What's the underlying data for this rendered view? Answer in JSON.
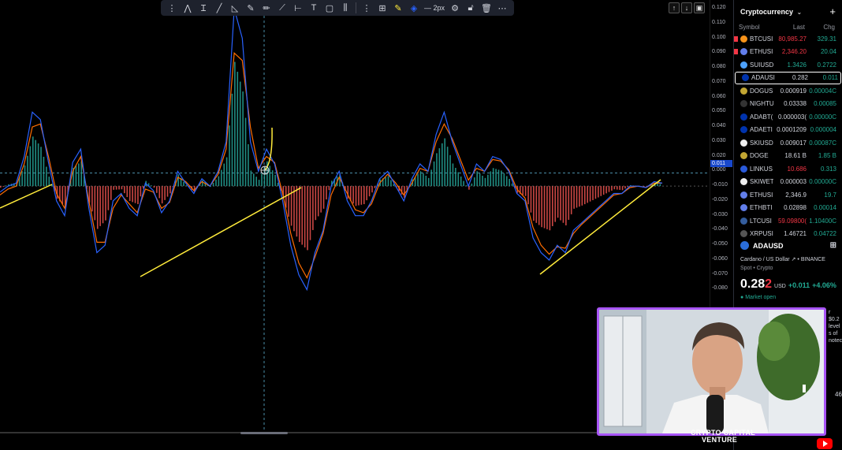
{
  "toolbar": {
    "line_width_label": "2px"
  },
  "price_axis": {
    "ticks": [
      "0.120",
      "0.110",
      "0.100",
      "0.090",
      "0.080",
      "0.070",
      "0.060",
      "0.050",
      "0.040",
      "0.030",
      "0.020",
      "0.011",
      "0.000",
      "-0.010",
      "-0.020",
      "-0.030",
      "-0.040",
      "-0.050",
      "-0.060",
      "-0.070",
      "-0.080"
    ],
    "highlight_label": "0.011",
    "highlight_color": "#1848cc"
  },
  "watchlist": {
    "title": "Cryptocurrency",
    "columns": {
      "symbol": "Symbol",
      "last": "Last",
      "chg": "Chg"
    },
    "rows": [
      {
        "symbol": "BTCUSI",
        "last": "80,985.27",
        "chg": "329.31",
        "last_color": "#f23645",
        "chg_color": "#22ab94",
        "coin_color": "#f7931a",
        "flag": true
      },
      {
        "symbol": "ETHUSI",
        "last": "2,346.20",
        "chg": "20.04",
        "last_color": "#f23645",
        "chg_color": "#22ab94",
        "coin_color": "#627eea",
        "flag": true
      },
      {
        "symbol": "SUIUSD",
        "last": "1.3426",
        "chg": "0.2722",
        "last_color": "#22ab94",
        "chg_color": "#22ab94",
        "coin_color": "#4da2ff",
        "flag": false
      },
      {
        "symbol": "ADAUSI",
        "last": "0.282",
        "chg": "0.011",
        "last_color": "#d1d4dc",
        "chg_color": "#22ab94",
        "coin_color": "#0033ad",
        "flag": false,
        "selected": true
      },
      {
        "symbol": "DOGUS",
        "last": "0.000919",
        "chg": "0.00004C",
        "last_color": "#d1d4dc",
        "chg_color": "#22ab94",
        "coin_color": "#c2a633",
        "flag": false
      },
      {
        "symbol": "NIGHTU",
        "last": "0.03338",
        "chg": "0.00085",
        "last_color": "#d1d4dc",
        "chg_color": "#22ab94",
        "coin_color": "#333333",
        "flag": false
      },
      {
        "symbol": "ADABT(",
        "last": "0.000003(",
        "chg": "0.00000C",
        "last_color": "#d1d4dc",
        "chg_color": "#22ab94",
        "coin_color": "#0033ad",
        "flag": false
      },
      {
        "symbol": "ADAETI",
        "last": "0.0001209",
        "chg": "0.000004",
        "last_color": "#d1d4dc",
        "chg_color": "#22ab94",
        "coin_color": "#0033ad",
        "flag": false
      },
      {
        "symbol": "SKIUSD",
        "last": "0.009017",
        "chg": "0.00087C",
        "last_color": "#d1d4dc",
        "chg_color": "#22ab94",
        "coin_color": "#eeeeee",
        "flag": false
      },
      {
        "symbol": "DOGE",
        "last": "18.61 B",
        "chg": "1.85 B",
        "last_color": "#d1d4dc",
        "chg_color": "#22ab94",
        "coin_color": "#c2a633",
        "flag": false
      },
      {
        "symbol": "LINKUS",
        "last": "10.686",
        "chg": "0.313",
        "last_color": "#f23645",
        "chg_color": "#22ab94",
        "coin_color": "#2a5ada",
        "flag": false
      },
      {
        "symbol": "SKIWET",
        "last": "0.000003",
        "chg": "0.00000C",
        "last_color": "#d1d4dc",
        "chg_color": "#22ab94",
        "coin_color": "#eeeeee",
        "flag": false
      },
      {
        "symbol": "ETHUSI",
        "last": "2,346.9",
        "chg": "19.7",
        "last_color": "#d1d4dc",
        "chg_color": "#22ab94",
        "coin_color": "#627eea",
        "flag": false
      },
      {
        "symbol": "ETHBTI",
        "last": "0.02898",
        "chg": "0.00014",
        "last_color": "#d1d4dc",
        "chg_color": "#22ab94",
        "coin_color": "#627eea",
        "flag": false
      },
      {
        "symbol": "LTCUSI",
        "last": "59.09800(",
        "chg": "1.10400C",
        "last_color": "#f23645",
        "chg_color": "#22ab94",
        "coin_color": "#345d9d",
        "flag": false
      },
      {
        "symbol": "XRPUSI",
        "last": "1.46721",
        "chg": "0.04722",
        "last_color": "#d1d4dc",
        "chg_color": "#22ab94",
        "coin_color": "#555555",
        "flag": false
      }
    ]
  },
  "details": {
    "symbol": "ADAUSD",
    "name": "Cardano / US Dollar",
    "exchange": "BINANCE",
    "type": "Spot • Crypto",
    "price_main": "0.28",
    "price_last_digit": "2",
    "currency": "USD",
    "change": "+0.011",
    "change_pct": "+4.06%",
    "market_status": "Market open",
    "partial_text": [
      "r $0.2",
      "level",
      "s of",
      "notec"
    ],
    "partial_number": "46"
  },
  "webcam": {
    "brand_line1": "CRYPTO CAPITAL",
    "brand_line2": "VENTURE"
  },
  "colors": {
    "macd_line": "#2962ff",
    "signal_line": "#ff6d00",
    "hist_pos": "#26a69a",
    "hist_neg": "#ef5350",
    "trendline": "#ffeb3b",
    "accent_purple": "#a855f7"
  },
  "chart_data": {
    "type": "line",
    "ylim": [
      -0.08,
      0.12
    ],
    "series": [
      {
        "values": [
          -0.004,
          0.0,
          0.002,
          0.02,
          0.05,
          0.045,
          0.016,
          -0.01,
          -0.02,
          0.016,
          0.025,
          -0.015,
          -0.045,
          -0.04,
          -0.01,
          -0.005,
          -0.015,
          -0.02,
          0.002,
          -0.003,
          -0.018,
          -0.01,
          0.01,
          0.002,
          -0.005,
          0.005,
          0.0,
          0.01,
          0.03,
          0.12,
          0.1,
          0.03,
          0.01,
          0.025,
          0.015,
          -0.01,
          -0.04,
          -0.06,
          -0.07,
          -0.045,
          -0.03,
          0.0,
          0.01,
          -0.01,
          -0.02,
          -0.02,
          -0.01,
          0.005,
          0.01,
          0.0,
          -0.01,
          0.005,
          0.015,
          0.01,
          0.035,
          0.05,
          0.03,
          0.015,
          0.0,
          0.015,
          0.01,
          0.02,
          0.018,
          0.01,
          -0.005,
          -0.01,
          -0.035,
          -0.045,
          -0.05,
          -0.04,
          -0.045,
          -0.03,
          -0.025,
          -0.02,
          -0.015,
          -0.01,
          -0.005,
          -0.005,
          0.0,
          0.0,
          -0.001,
          0.003,
          0.002
        ]
      },
      {
        "values": [
          -0.006,
          -0.002,
          0.0,
          0.015,
          0.04,
          0.042,
          0.02,
          -0.005,
          -0.015,
          0.01,
          0.02,
          -0.01,
          -0.038,
          -0.038,
          -0.015,
          -0.006,
          -0.012,
          -0.018,
          -0.002,
          -0.004,
          -0.015,
          -0.011,
          0.006,
          0.003,
          -0.003,
          0.003,
          0.0,
          0.008,
          0.025,
          0.09,
          0.085,
          0.04,
          0.012,
          0.02,
          0.016,
          -0.005,
          -0.032,
          -0.052,
          -0.062,
          -0.048,
          -0.032,
          -0.006,
          0.006,
          -0.005,
          -0.016,
          -0.018,
          -0.012,
          0.002,
          0.008,
          0.002,
          -0.006,
          0.002,
          0.012,
          0.01,
          0.03,
          0.042,
          0.032,
          0.018,
          0.004,
          0.012,
          0.01,
          0.018,
          0.017,
          0.011,
          -0.002,
          -0.008,
          -0.028,
          -0.04,
          -0.046,
          -0.041,
          -0.042,
          -0.032,
          -0.026,
          -0.021,
          -0.016,
          -0.011,
          -0.006,
          -0.005,
          -0.001,
          0.0,
          -0.001,
          0.002,
          0.002
        ]
      }
    ]
  }
}
